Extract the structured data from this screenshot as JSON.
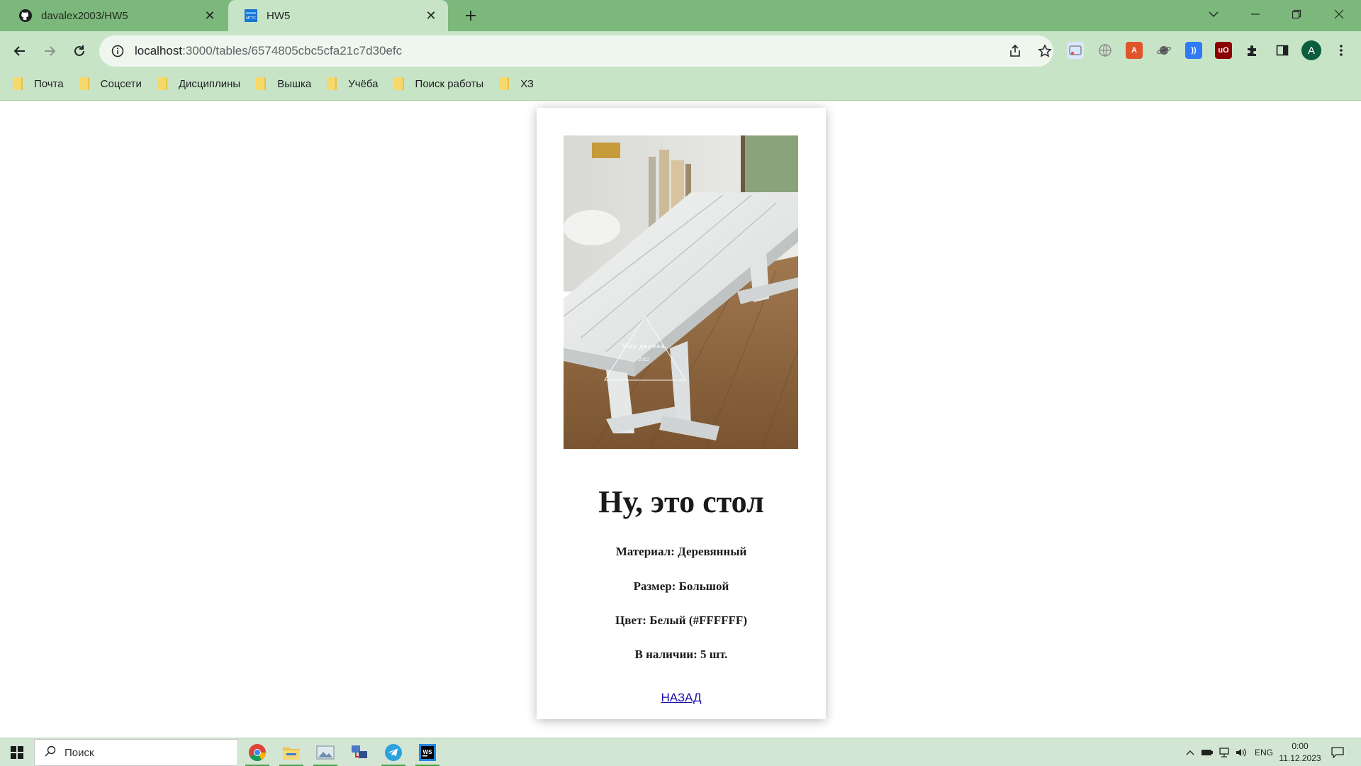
{
  "browser": {
    "tabs": [
      {
        "title": "davalex2003/HW5",
        "icon": "github-icon"
      },
      {
        "title": "HW5",
        "icon": "site-favicon",
        "favicon_text": "МГТС"
      }
    ],
    "url_host": "localhost",
    "url_path": ":3000/tables/6574805cbc5cfa21c7d30efc",
    "avatar_letter": "A",
    "bookmarks": [
      "Почта",
      "Соцсети",
      "Дисциплины",
      "Вышка",
      "Учёба",
      "Поиск работы",
      "ХЗ"
    ]
  },
  "product": {
    "image": {
      "description_icon": "white-wooden-table-photo",
      "watermark_line1": "Мир дерева",
      "watermark_line2": "2012"
    },
    "title": "Ну, это стол",
    "material": "Материал: Деревянный",
    "size": "Размер: Большой",
    "color": "Цвет: Белый (#FFFFFF)",
    "stock": "В наличии: 5 шт.",
    "back_link": "НАЗАД"
  },
  "taskbar": {
    "search_placeholder": "Поиск",
    "language": "ENG",
    "time": "0:00",
    "date": "11.12.2023"
  },
  "colors": {
    "tabstrip": "#7cb87c",
    "toolbar": "#c7e4c7",
    "link": "#1a0dab"
  }
}
